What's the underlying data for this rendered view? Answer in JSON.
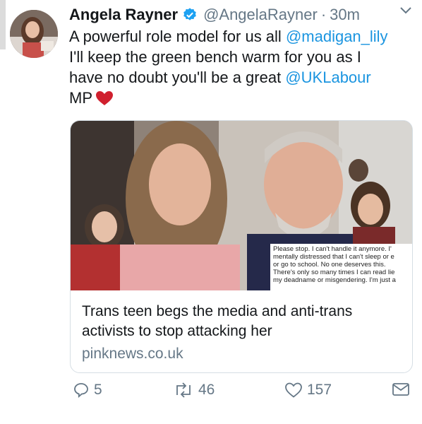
{
  "tweet": {
    "author_name": "Angela Rayner",
    "handle": "@AngelaRayner",
    "separator": "·",
    "time": "30m",
    "text_line1_prefix": "A powerful role model for us all ",
    "mention1": "@madigan_lily",
    "text_line2": "I'll keep the green bench warm for you as I",
    "text_line3_prefix": "have no doubt you'll be a great ",
    "mention2": "@UKLabour",
    "text_line4": "MP"
  },
  "card": {
    "title": "Trans teen begs the media and anti-trans activists to stop attacking her",
    "domain": "pinknews.co.uk",
    "overlay_lines": [
      "Please stop. I can't handle it anymore. I'",
      "mentally distressed that I can't sleep or e",
      "or go to school. No one deserves this.",
      "There's only so many times I can read lie",
      "my deadname or misgendering. I'm just a"
    ]
  },
  "actions": {
    "replies": "5",
    "retweets": "46",
    "likes": "157"
  },
  "icons": [
    "verified-icon",
    "chevron-down-icon",
    "heart-emoji-icon",
    "reply-icon",
    "retweet-icon",
    "like-icon",
    "direct-message-icon"
  ],
  "colors": {
    "link": "#1b95e0",
    "secondary_text": "#657786",
    "verified": "#1da1f2",
    "heart_emoji": "#d0202e"
  }
}
